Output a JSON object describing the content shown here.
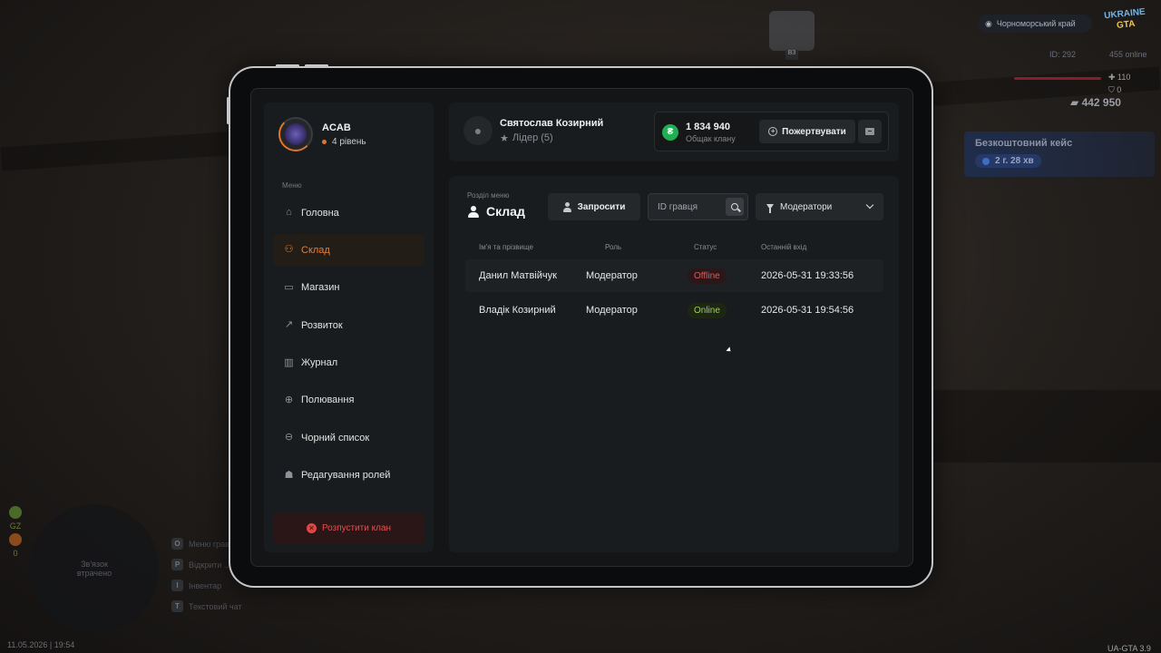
{
  "game_hud": {
    "region": "Чорноморський край",
    "logo_top": "UKRAINE",
    "logo_bottom": "GTA",
    "player_id": "ID: 292",
    "online": "455 online",
    "health": "110",
    "armor": "0",
    "money": "442 950",
    "case_title": "Безкоштовний кейс",
    "case_timer": "2 г. 28 хв",
    "gz_label": "GZ",
    "gz_count": "0",
    "minimap_text": "Зв'язок втрачено",
    "hints": [
      {
        "key": "O",
        "label": "Меню гравця"
      },
      {
        "key": "P",
        "label": "Відкрити ..."
      },
      {
        "key": "I",
        "label": "Інвентар"
      },
      {
        "key": "T",
        "label": "Текстовий чат"
      }
    ],
    "datetime": "11.05.2026 | 19:54",
    "version": "UA-GTA 3.9",
    "car_tag": "B3"
  },
  "clan": {
    "name": "ACAB",
    "level": "4 рівень",
    "menu_caption": "Меню",
    "menu": [
      {
        "label": "Головна",
        "icon": "home-icon",
        "active": false
      },
      {
        "label": "Склад",
        "icon": "users-icon",
        "active": true
      },
      {
        "label": "Магазин",
        "icon": "basket-icon",
        "active": false
      },
      {
        "label": "Розвиток",
        "icon": "chart-icon",
        "active": false
      },
      {
        "label": "Журнал",
        "icon": "book-icon",
        "active": false
      },
      {
        "label": "Полювання",
        "icon": "crosshair-icon",
        "active": false
      },
      {
        "label": "Чорний список",
        "icon": "minus-circle-icon",
        "active": false
      },
      {
        "label": "Редагування ролей",
        "icon": "user-edit-icon",
        "active": false
      }
    ],
    "dissolve_label": "Розпустити клан"
  },
  "leader": {
    "name": "Святослав Козирний",
    "rank": "Лідер (5)"
  },
  "bank": {
    "amount": "1 834 940",
    "label": "Общак клану",
    "currency_symbol": "₴",
    "donate_label": "Пожертвувати"
  },
  "section": {
    "caption": "Розділ меню",
    "title": "Склад",
    "invite_label": "Запросити",
    "search_placeholder": "ID гравця",
    "filter_value": "Модератори"
  },
  "table": {
    "headers": {
      "name": "Ім'я та прізвище",
      "role": "Роль",
      "status": "Статус",
      "last": "Останній вхід"
    },
    "rows": [
      {
        "name": "Данил Матвійчук",
        "role": "Модератор",
        "status": "Offline",
        "last": "2026-05-31 19:33:56"
      },
      {
        "name": "Владік Козирний",
        "role": "Модератор",
        "status": "Online",
        "last": "2026-05-31 19:54:56"
      }
    ]
  },
  "colors": {
    "accent": "#e47f3a",
    "danger": "#e05252",
    "online": "#9ad24a",
    "currency": "#1fae52"
  }
}
